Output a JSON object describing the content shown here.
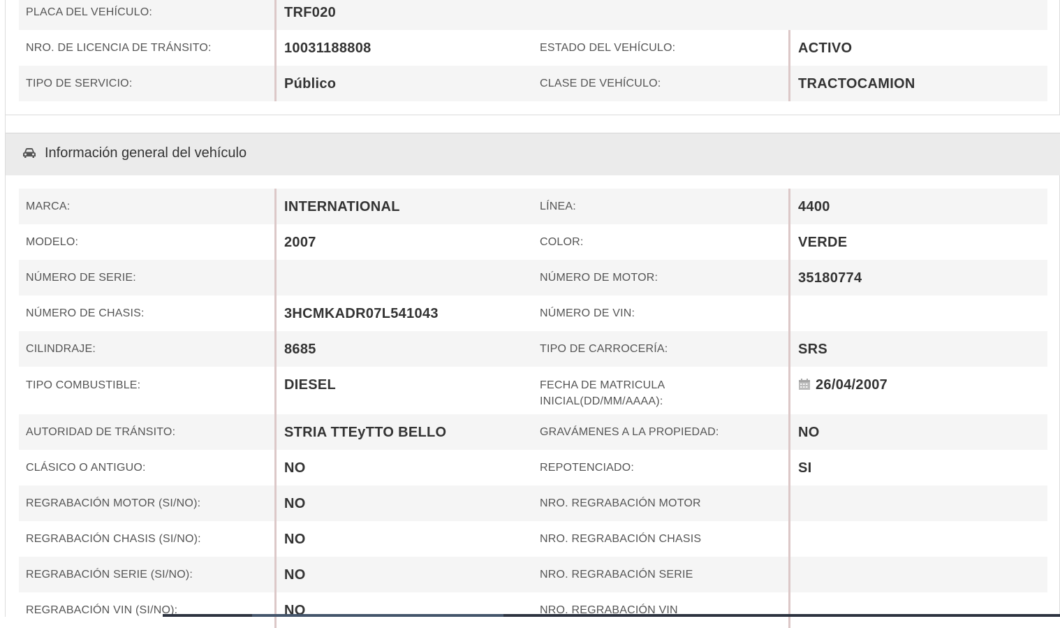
{
  "top_rows": [
    {
      "label": "PLACA DEL VEHÍCULO:",
      "value": "TRF020",
      "label2": "",
      "value2": ""
    },
    {
      "label": "NRO. DE LICENCIA DE TRÁNSITO:",
      "value": "10031188808",
      "label2": "ESTADO DEL VEHÍCULO:",
      "value2": "ACTIVO"
    },
    {
      "label": "TIPO DE SERVICIO:",
      "value": "Público",
      "label2": "CLASE DE VEHÍCULO:",
      "value2": "TRACTOCAMION"
    }
  ],
  "section": {
    "title": "Información general del vehículo",
    "icon": "car-icon"
  },
  "rows": [
    {
      "label": "MARCA:",
      "value": "INTERNATIONAL",
      "label2": "LÍNEA:",
      "value2": "4400"
    },
    {
      "label": "MODELO:",
      "value": "2007",
      "label2": "COLOR:",
      "value2": "VERDE"
    },
    {
      "label": "NÚMERO DE SERIE:",
      "value": "",
      "label2": "NÚMERO DE MOTOR:",
      "value2": "35180774"
    },
    {
      "label": "NÚMERO DE CHASIS:",
      "value": "3HCMKADR07L541043",
      "label2": "NÚMERO DE VIN:",
      "value2": ""
    },
    {
      "label": "CILINDRAJE:",
      "value": "8685",
      "label2": "TIPO DE CARROCERÍA:",
      "value2": "SRS"
    },
    {
      "label": "TIPO COMBUSTIBLE:",
      "value": "DIESEL",
      "label2": "FECHA DE MATRICULA INICIAL(DD/MM/AAAA):",
      "value2": "26/04/2007",
      "value2_icon": "calendar-icon"
    },
    {
      "label": "AUTORIDAD DE TRÁNSITO:",
      "value": "STRIA TTEyTTO BELLO",
      "label2": "GRAVÁMENES A LA PROPIEDAD:",
      "value2": "NO"
    },
    {
      "label": "CLÁSICO O ANTIGUO:",
      "value": "NO",
      "label2": "REPOTENCIADO:",
      "value2": "SI"
    },
    {
      "label": "REGRABACIÓN MOTOR (SI/NO):",
      "value": "NO",
      "label2": "NRO. REGRABACIÓN MOTOR",
      "value2": ""
    },
    {
      "label": "REGRABACIÓN CHASIS (SI/NO):",
      "value": "NO",
      "label2": "NRO. REGRABACIÓN CHASIS",
      "value2": ""
    },
    {
      "label": "REGRABACIÓN SERIE (SI/NO):",
      "value": "NO",
      "label2": "NRO. REGRABACIÓN SERIE",
      "value2": ""
    },
    {
      "label": "REGRABACIÓN VIN (SI/NO):",
      "value": "NO",
      "label2": "NRO. REGRABACIÓN VIN",
      "value2": ""
    }
  ],
  "colors": {
    "odd_row": "#f5f5f5",
    "header_bg": "#ebebeb",
    "divider": "#dcc8c8"
  }
}
